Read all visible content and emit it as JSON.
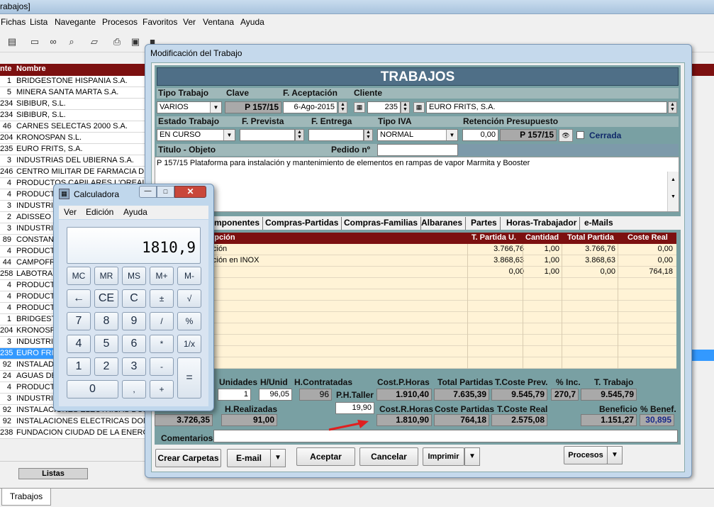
{
  "app": {
    "title_fragment": "rabajos]"
  },
  "menu": [
    "Fichas",
    "Lista",
    "Navegante",
    "Procesos",
    "Favoritos",
    "Ver",
    "Ventana",
    "Ayuda"
  ],
  "list": {
    "header": {
      "code": "nte",
      "name": "Nombre"
    },
    "rows": [
      {
        "code": "1",
        "name": "BRIDGESTONE HISPANIA S.A."
      },
      {
        "code": "5",
        "name": "MINERA SANTA MARTA S.A."
      },
      {
        "code": "234",
        "name": "SIBIBUR, S.L."
      },
      {
        "code": "234",
        "name": "SIBIBUR, S.L."
      },
      {
        "code": "46",
        "name": "CARNES SELECTAS 2000 S.A."
      },
      {
        "code": "204",
        "name": "KRONOSPAN S.L."
      },
      {
        "code": "235",
        "name": "EURO FRITS, S.A."
      },
      {
        "code": "3",
        "name": "INDUSTRIAS DEL UBIERNA S.A."
      },
      {
        "code": "246",
        "name": "CENTRO MILITAR DE FARMACIA DE"
      },
      {
        "code": "4",
        "name": "PRODUCTOS CAPILARES L'OREAL"
      },
      {
        "code": "4",
        "name": "PRODUCT"
      },
      {
        "code": "3",
        "name": "INDUSTRI"
      },
      {
        "code": "2",
        "name": "ADISSEO"
      },
      {
        "code": "3",
        "name": "INDUSTRI"
      },
      {
        "code": "89",
        "name": "CONSTAN"
      },
      {
        "code": "4",
        "name": "PRODUCT"
      },
      {
        "code": "44",
        "name": "CAMPOFR"
      },
      {
        "code": "258",
        "name": "LABOTRA"
      },
      {
        "code": "4",
        "name": "PRODUCT"
      },
      {
        "code": "4",
        "name": "PRODUCT"
      },
      {
        "code": "4",
        "name": "PRODUCT"
      },
      {
        "code": "1",
        "name": "BRIDGEST"
      },
      {
        "code": "204",
        "name": "KRONOSP"
      },
      {
        "code": "3",
        "name": "INDUSTRI"
      },
      {
        "code": "235",
        "name": "EURO FRI"
      },
      {
        "code": "92",
        "name": "INSTALAD"
      },
      {
        "code": "24",
        "name": "AGUAS DE"
      },
      {
        "code": "4",
        "name": "PRODUCT"
      },
      {
        "code": "3",
        "name": "INDUSTRI"
      },
      {
        "code": "92",
        "name": "INSTALACIONES ELECTRICAS DOM"
      },
      {
        "code": "92",
        "name": "INSTALACIONES ELECTRICAS DOM"
      },
      {
        "code": "238",
        "name": "FUNDACION CIUDAD DE LA ENERG"
      }
    ],
    "selected_index": 24,
    "listas_button": "Listas"
  },
  "bottom_tab": "Trabajos",
  "dialog": {
    "title": "Modificación del Trabajo",
    "banner": "TRABAJOS",
    "row1_labels": {
      "tipo": "Tipo Trabajo",
      "clave": "Clave",
      "fecha": "F. Aceptación",
      "cliente": "Cliente"
    },
    "tipo_trabajo": "VARIOS",
    "clave": "P 157/15",
    "fecha_aceptacion": "6-Ago-2015",
    "cliente_num": "235",
    "cliente_nombre": "EURO FRITS, S.A.",
    "row2_labels": {
      "estado": "Estado Trabajo",
      "prevista": "F. Prevista",
      "entrega": "F. Entrega",
      "iva": "Tipo IVA",
      "retencion": "Retención Presupuesto"
    },
    "estado": "EN CURSO",
    "tipo_iva": "NORMAL",
    "retencion": "0,00",
    "presupuesto": "P 157/15",
    "cerrada_label": "Cerrada",
    "titulo_label": "Titulo - Objeto",
    "pedido_label": "Pedido nº",
    "descripcion": "P 157/15 Plataforma para instalación y mantenimiento de elementos en rampas de vapor Marmita y Booster",
    "tabs": [
      "mponentes",
      "Compras-Partidas",
      "Compras-Familias",
      "Albaranes",
      "Partes",
      "Horas-Trabajador",
      "e-Mails"
    ],
    "grid": {
      "headers": [
        "rpción",
        "T. Partida U.",
        "Cantidad",
        "Total Partida",
        "Coste Real"
      ],
      "rows": [
        [
          "ción",
          "3.766,76",
          "1,00",
          "3.766,76",
          "0,00"
        ],
        [
          "ción en INOX",
          "3.868,63",
          "1,00",
          "3.868,63",
          "0,00"
        ],
        [
          "",
          "0,00",
          "1,00",
          "0,00",
          "764,18"
        ]
      ]
    },
    "totals": {
      "labels": {
        "unidades": "Unidades",
        "hunid": "H/Unid",
        "hcontratadas": "H.Contratadas",
        "costph": "Cost.P.Horas",
        "totalpartidas": "Total Partidas",
        "tcosteprev": "T.Coste Prev.",
        "inc": "% Inc.",
        "ttrabajo": "T. Trabajo",
        "phtaller": "P.H.Taller",
        "hrealizadas": "H.Realizadas",
        "costrh": "Cost.R.Horas",
        "costepartidas": "Coste Partidas",
        "tcostereal": "T.Coste Real",
        "beneficio": "Beneficio",
        "pbenef": "% Benef.",
        "comentarios": "Comentarios"
      },
      "unidades": "1",
      "hunid": "96,05",
      "hcontratadas": "96",
      "costph": "1.910,40",
      "totalpartidas": "7.635,39",
      "tcosteprev": "9.545,79",
      "inc": "270,7",
      "ttrabajo": "9.545,79",
      "phtaller": "19,90",
      "left_total": "3.726,35",
      "hrealizadas": "91,00",
      "costrh": "1.810,90",
      "costepartidas": "764,18",
      "tcostereal": "2.575,08",
      "beneficio": "1.151,27",
      "pbenef": "30,895"
    },
    "buttons": {
      "crear": "Crear Carpetas",
      "email": "E-mail",
      "aceptar": "Aceptar",
      "cancelar": "Cancelar",
      "imprimir": "Imprimir",
      "procesos": "Procesos"
    }
  },
  "calculator": {
    "title": "Calculadora",
    "menu": [
      "Ver",
      "Edición",
      "Ayuda"
    ],
    "display": "1810,9",
    "keys": [
      "MC",
      "MR",
      "MS",
      "M+",
      "M-",
      "←",
      "CE",
      "C",
      "±",
      "√",
      "7",
      "8",
      "9",
      "/",
      "%",
      "4",
      "5",
      "6",
      "*",
      "1/x",
      "1",
      "2",
      "3",
      "-",
      "=",
      "0",
      ",",
      "+"
    ]
  },
  "colors": {
    "accent_red": "#7c1010",
    "teal": "#79a0a3",
    "banner": "#4f6f87",
    "selection": "#3399ff",
    "arrow": "#e02020"
  }
}
